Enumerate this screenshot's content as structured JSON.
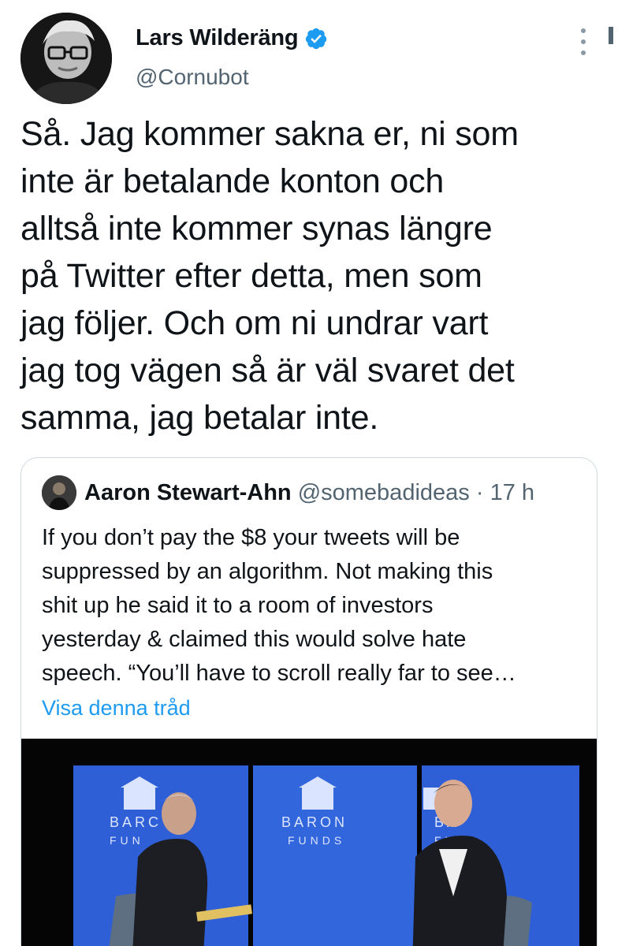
{
  "author": {
    "name": "Lars Wilderäng",
    "handle": "@Cornubot",
    "verified": true
  },
  "tweet": {
    "lines": [
      "Så. Jag kommer sakna er, ni som",
      "inte är betalande konton och",
      "alltså inte kommer synas längre",
      "på Twitter efter detta, men som",
      "jag följer. Och om ni undrar vart",
      "jag tog vägen så är väl svaret det",
      "samma, jag betalar inte."
    ]
  },
  "quote": {
    "name": "Aaron Stewart-Ahn",
    "handle": "@somebadideas",
    "separator": "·",
    "time": "17 h",
    "lines": [
      "If you don’t pay the $8 your tweets will be",
      "suppressed by an algorithm. Not making this",
      "shit up he said it to a room of investors",
      "yesterday & claimed this would solve hate",
      "speech. “You’ll have to scroll really far to see…"
    ],
    "show_thread": "Visa denna tråd",
    "media": {
      "stage_text": [
        "BARC",
        "FUN",
        "BARON",
        "FUNDS",
        "BA",
        "FU"
      ]
    }
  },
  "colors": {
    "accent": "#1d9bf0",
    "text": "#0f1419",
    "secondary": "#536471",
    "border": "#cfd9de",
    "stage_blue": "#2f5fd6"
  },
  "icons": [
    "verified-badge-icon",
    "more-options-icon"
  ]
}
